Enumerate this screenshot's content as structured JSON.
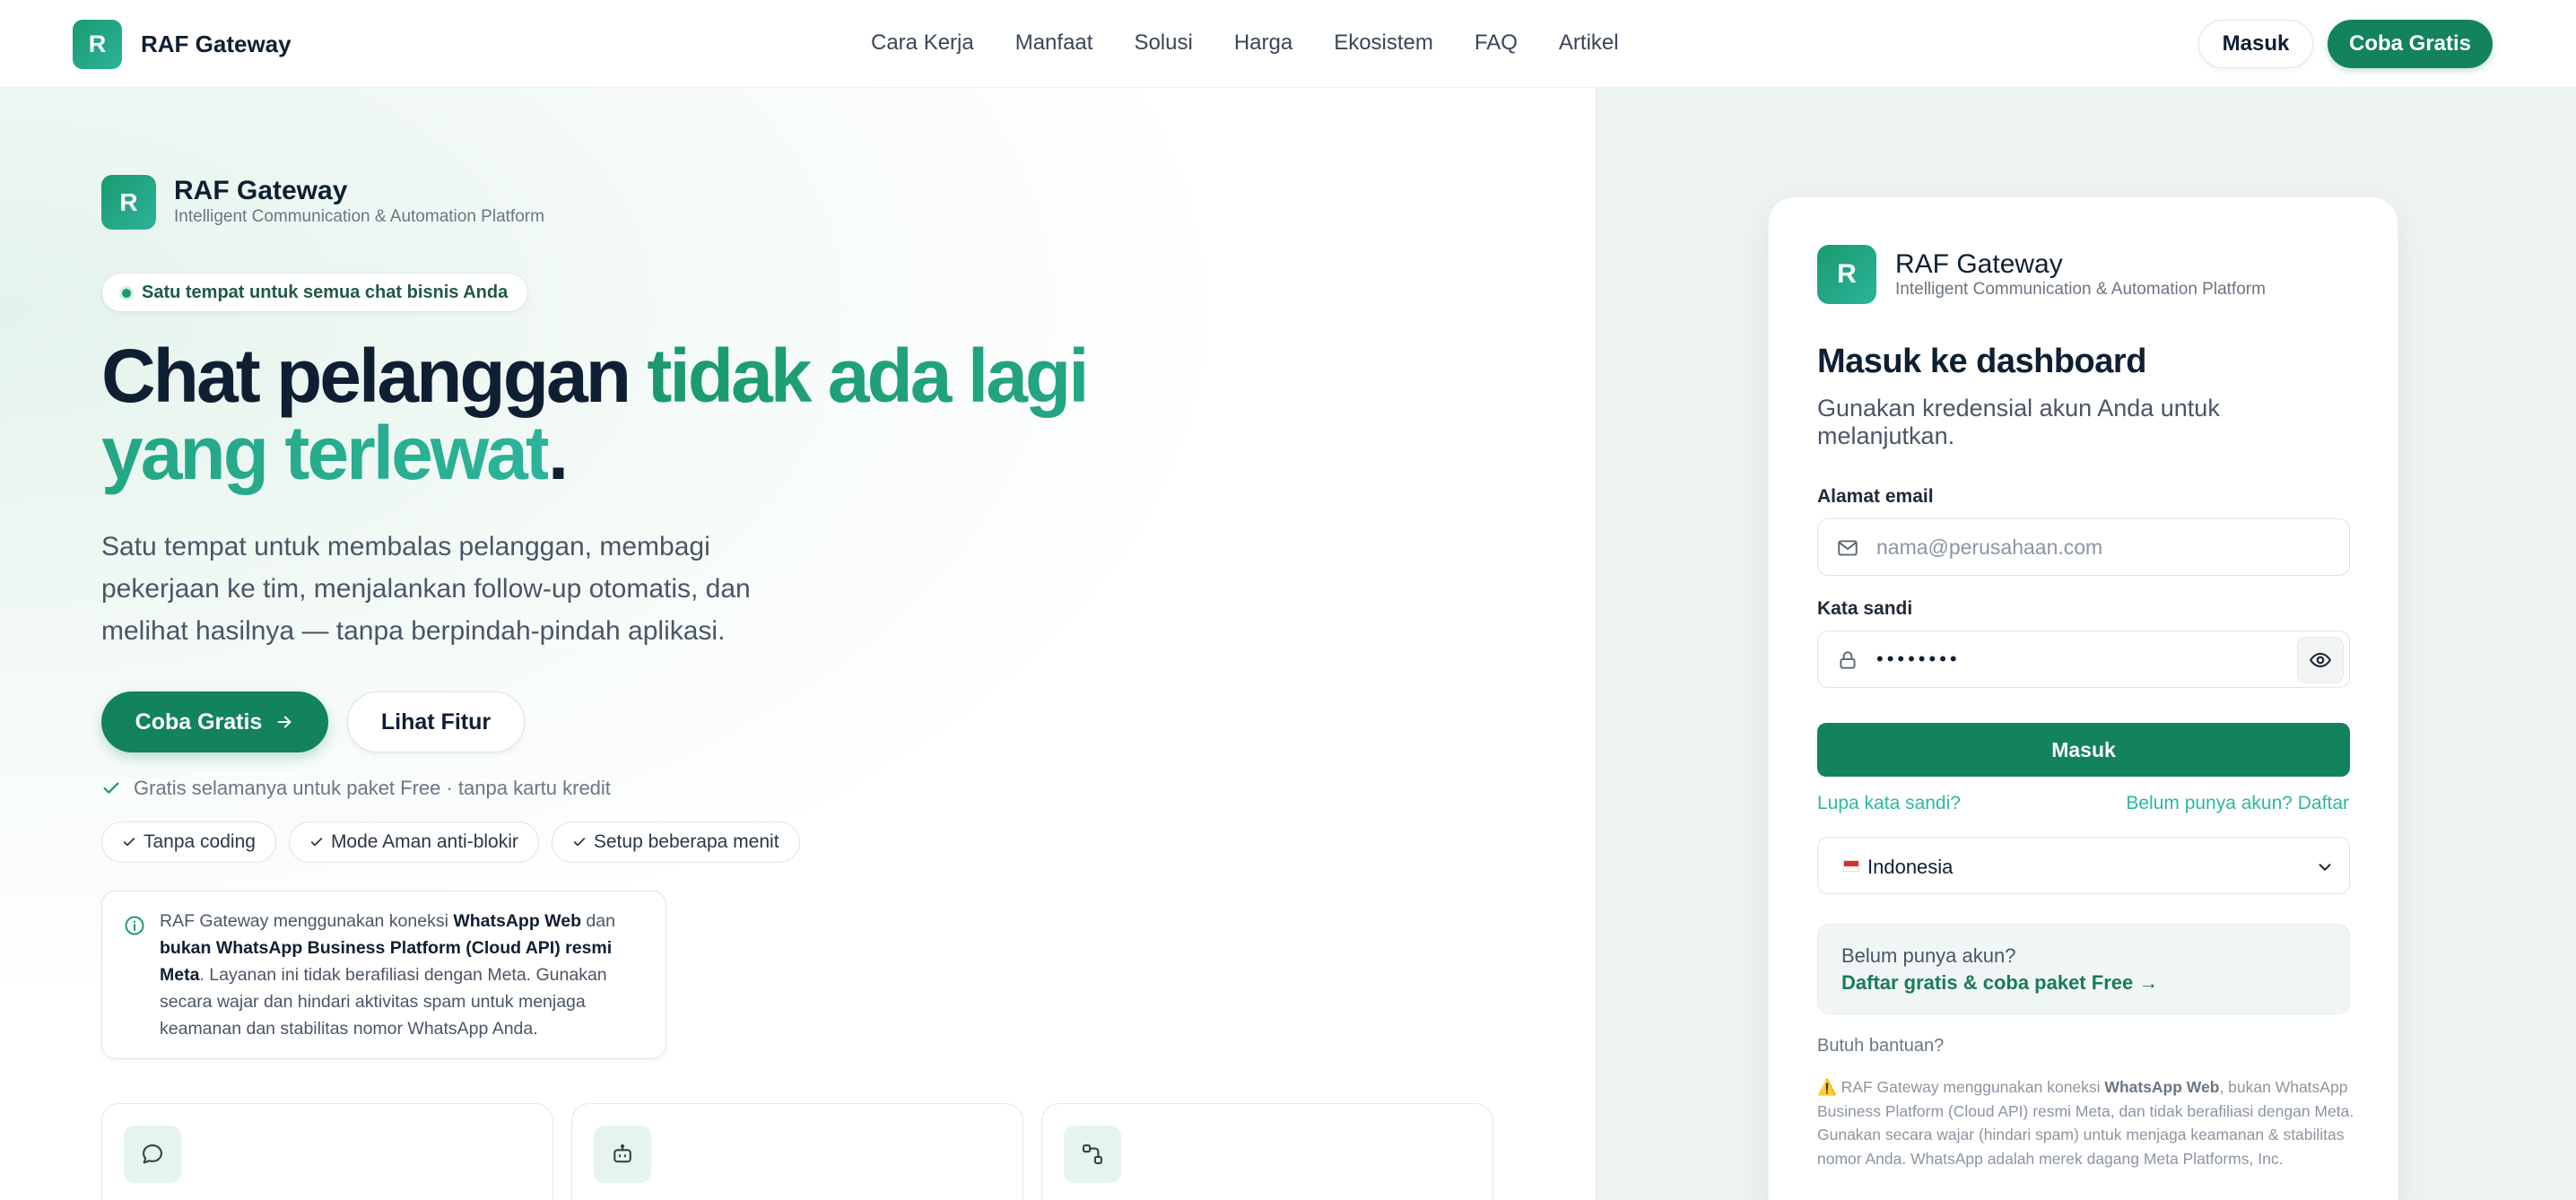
{
  "nav": {
    "logo_letter": "R",
    "brand": "RAF Gateway",
    "links": [
      "Cara Kerja",
      "Manfaat",
      "Solusi",
      "Harga",
      "Ekosistem",
      "FAQ",
      "Artikel"
    ],
    "login_label": "Masuk",
    "cta_label": "Coba Gratis"
  },
  "hero": {
    "logo_letter": "R",
    "brand": "RAF Gateway",
    "tagline": "Intelligent Communication & Automation Platform",
    "pill": "Satu tempat untuk semua chat bisnis Anda",
    "headline": {
      "part1": "Chat pelanggan ",
      "highlight": "tidak ada lagi yang terlewat",
      "end": "."
    },
    "subtext": "Satu tempat untuk membalas pelanggan, membagi pekerjaan ke tim, menjalankan follow-up otomatis, dan melihat hasilnya — tanpa berpindah-pindah aplikasi.",
    "cta_primary": "Coba Gratis",
    "cta_secondary": "Lihat Fitur",
    "free_note": "Gratis selamanya untuk paket Free · tanpa kartu kredit",
    "chips": [
      "Tanpa coding",
      "Mode Aman anti-blokir",
      "Setup beberapa menit"
    ],
    "info": {
      "t1": "RAF Gateway menggunakan koneksi ",
      "b1": "WhatsApp Web",
      "t2": " dan ",
      "b2": "bukan WhatsApp Business Platform (Cloud API) resmi Meta",
      "t3": ". Layanan ini tidak berafiliasi dengan Meta. Gunakan secara wajar dan hindari aktivitas spam untuk menjaga keamanan dan stabilitas nomor WhatsApp Anda."
    },
    "feature_icons": [
      "chat-bubble-icon",
      "robot-icon",
      "workflow-icon"
    ]
  },
  "login": {
    "logo_letter": "R",
    "brand": "RAF Gateway",
    "tagline": "Intelligent Communication & Automation Platform",
    "title": "Masuk ke dashboard",
    "subtitle": "Gunakan kredensial akun Anda untuk melanjutkan.",
    "email_label": "Alamat email",
    "email_placeholder": "nama@perusahaan.com",
    "password_label": "Kata sandi",
    "password_value": "••••••••",
    "submit_label": "Masuk",
    "forgot_label": "Lupa kata sandi?",
    "register_label": "Belum punya akun? Daftar",
    "language": "Indonesia",
    "promo_question": "Belum punya akun?",
    "promo_link": "Daftar gratis & coba paket Free →",
    "help_label": "Butuh bantuan?",
    "disclaimer": {
      "warn": "⚠️ RAF Gateway menggunakan koneksi ",
      "b1": "WhatsApp Web",
      "rest": ", bukan WhatsApp Business Platform (Cloud API) resmi Meta, dan tidak berafiliasi dengan Meta. Gunakan secara wajar (hindari spam) untuk menjaga keamanan & stabilitas nomor Anda. WhatsApp adalah merek dagang Meta Platforms, Inc."
    }
  },
  "colors": {
    "primary": "#12825f",
    "accent": "#2cb39a",
    "text": "#0f1f33",
    "muted": "#6b7684"
  }
}
